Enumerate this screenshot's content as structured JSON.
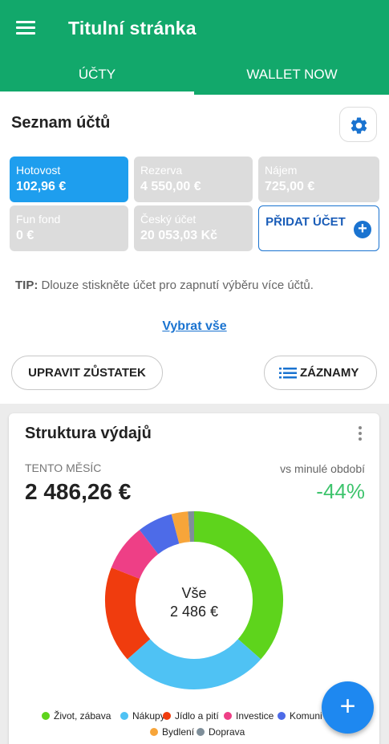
{
  "appbar": {
    "title": "Titulní stránka",
    "tabs": [
      {
        "label": "ÚČTY",
        "active": true
      },
      {
        "label": "WALLET NOW",
        "active": false
      }
    ]
  },
  "accounts_section": {
    "title": "Seznam účtů",
    "accounts": [
      {
        "name": "Hotovost",
        "balance": "102,96 €",
        "active": true
      },
      {
        "name": "Rezerva",
        "balance": "4 550,00 €",
        "active": false
      },
      {
        "name": "Nájem",
        "balance": "725,00 €",
        "active": false
      },
      {
        "name": "Fun fond",
        "balance": "0 €",
        "active": false
      },
      {
        "name": "Český účet",
        "balance": "20 053,03 Kč",
        "active": false
      }
    ],
    "add_account_label": "PŘIDAT ÚČET",
    "tip_prefix": "TIP:",
    "tip_text": " Dlouze stiskněte účet pro zapnutí výběru více účtů.",
    "select_all": "Vybrat vše",
    "edit_balance": "UPRAVIT ZŮSTATEK",
    "records": "ZÁZNAMY"
  },
  "expense_card": {
    "title": "Struktura výdajů",
    "period": "TENTO MĚSÍC",
    "compare_label": "vs minulé období",
    "total": "2 486,26 €",
    "delta": "-44%",
    "center_label": "Vše",
    "center_value": "2 486 €"
  },
  "chart_data": {
    "type": "pie",
    "title": "Struktura výdajů",
    "categories": [
      "Život, zábava",
      "Nákupy",
      "Jídlo a pití",
      "Investice",
      "Komuni",
      "Bydlení",
      "Doprava"
    ],
    "values": [
      36.5,
      27.0,
      17.5,
      8.5,
      6.4,
      3.0,
      1.1
    ],
    "colors": [
      "#5ed41c",
      "#4fc2f4",
      "#f03c0e",
      "#ee3f86",
      "#4d6be8",
      "#f7a53a",
      "#7f8f9a"
    ],
    "legend": "bottom",
    "start_angle_deg": 90
  },
  "fab": {
    "label": "+"
  }
}
